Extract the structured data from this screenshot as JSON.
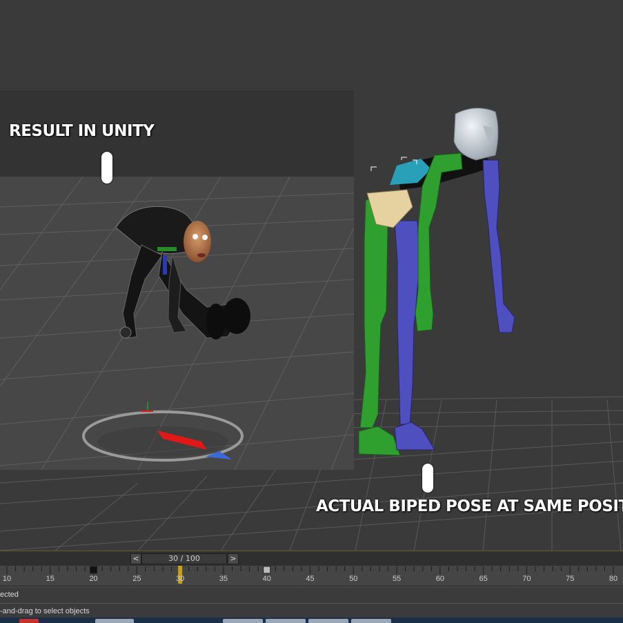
{
  "viewport": {
    "caption_unity": "RESULT IN UNITY",
    "caption_biped": "ACTUAL BIPED POSE AT SAME POSITION"
  },
  "timebar": {
    "prev_label": "<",
    "next_label": ">",
    "frame_readout": "30 / 100",
    "current_frame": 30,
    "total_frames": 100
  },
  "trackbar": {
    "tick_labels": [
      "10",
      "15",
      "20",
      "25",
      "30",
      "35",
      "40",
      "45",
      "50",
      "55",
      "60",
      "65",
      "70",
      "75",
      "80"
    ],
    "keyframes": [
      20,
      40
    ]
  },
  "status": {
    "selection_text": "ected",
    "prompt_text": "-and-drag to select objects"
  },
  "colors": {
    "biped_left": "#2fa02f",
    "biped_right": "#4f4fc0",
    "biped_head": "#c8d0d8",
    "gizmo_red": "#e01818",
    "gizmo_blue": "#3a6ad8",
    "time_slider_marker": "#c8a018"
  }
}
